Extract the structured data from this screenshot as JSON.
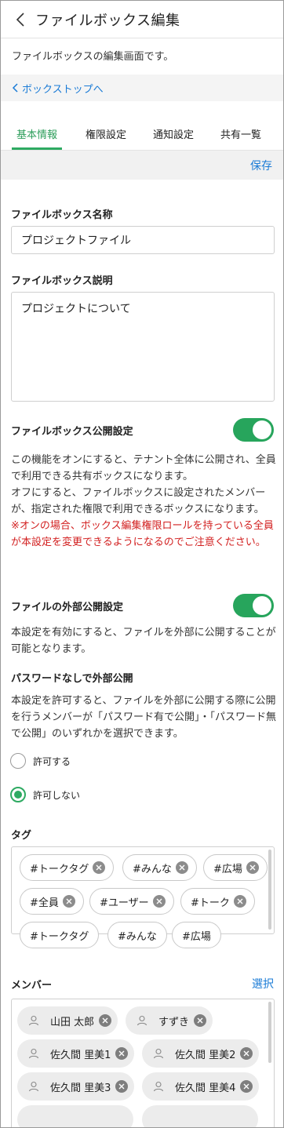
{
  "header": {
    "title": "ファイルボックス編集",
    "description": "ファイルボックスの編集画面です。"
  },
  "breadcrumb": {
    "label": "ボックストップへ"
  },
  "tabs": [
    {
      "label": "基本情報",
      "active": true
    },
    {
      "label": "権限設定",
      "active": false
    },
    {
      "label": "通知設定",
      "active": false
    },
    {
      "label": "共有一覧",
      "active": false
    }
  ],
  "toolbar": {
    "save_label": "保存"
  },
  "form": {
    "name_label": "ファイルボックス名称",
    "name_value": "プロジェクトファイル",
    "desc_label": "ファイルボックス説明",
    "desc_value": "プロジェクトについて",
    "public_label": "ファイルボックス公開設定",
    "public_on": true,
    "public_help_1": "この機能をオンにすると、テナント全体に公開され、全員で利用できる共有ボックスになります。",
    "public_help_2": "オフにすると、ファイルボックスに設定されたメンバーが、指定された権限で利用できるボックスになります。",
    "public_warning": "※オンの場合、ボックス編集権限ロールを持っている全員が本設定を変更できるようになるのでご注意ください。",
    "external_label": "ファイルの外部公開設定",
    "external_on": true,
    "external_help": "本設定を有効にすると、ファイルを外部に公開することが可能となります。",
    "nopass_label": "パスワードなしで外部公開",
    "nopass_help": "本設定を許可すると、ファイルを外部に公開する際に公開を行うメンバーが「パスワード有で公開」・「パスワード無で公開」のいずれかを選択できます。",
    "radio_allow": "許可する",
    "radio_deny": "許可しない",
    "radio_selected": "許可しない",
    "tags_label": "タグ",
    "tags": [
      "#トークタグ",
      "#みんな",
      "#広場",
      "#全員",
      "#ユーザー",
      "#トーク",
      "#トークタグ",
      "#みんな",
      "#広場"
    ],
    "members_label": "メンバー",
    "members_select": "選択",
    "members": [
      "山田 太郎",
      "すずき",
      "佐久間 里美1",
      "佐久間 里美2",
      "佐久間 里美3",
      "佐久間 里美4"
    ]
  },
  "colors": {
    "accent_green": "#2eaa62",
    "link_blue": "#1a7bd6",
    "warning_red": "#d21f1f"
  }
}
